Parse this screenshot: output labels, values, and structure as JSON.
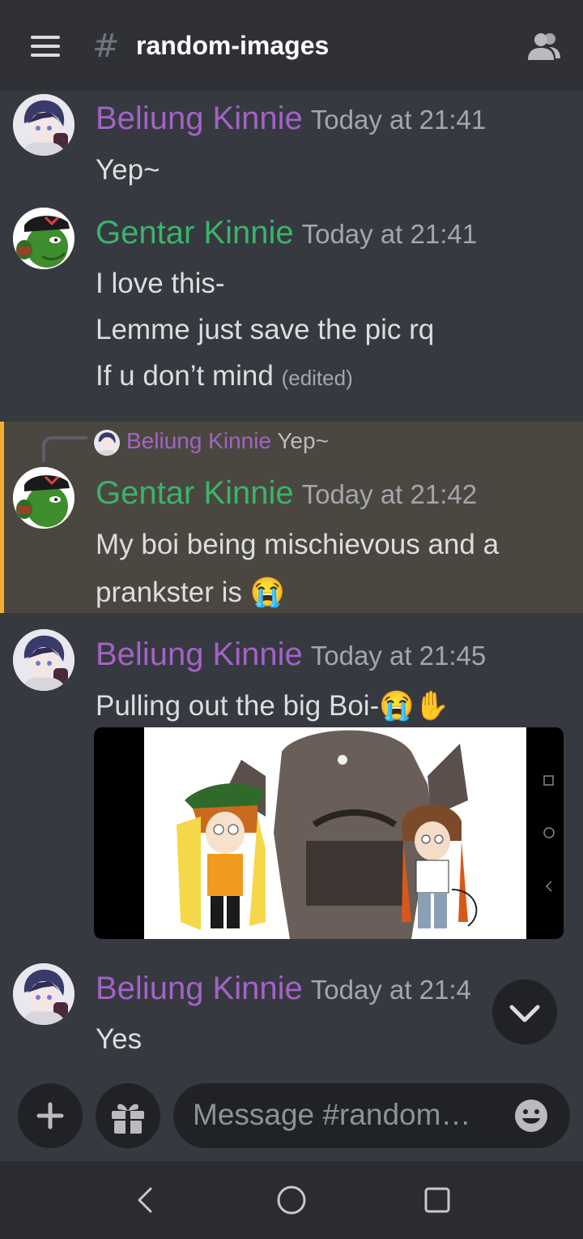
{
  "header": {
    "channel_prefix": "#",
    "channel_name": "random-images",
    "menu_icon": "hamburger-menu-icon",
    "members_icon": "members-icon"
  },
  "messages": [
    {
      "author": "Beliung Kinnie",
      "author_color": "#a363c6",
      "timestamp": "Today at 21:41",
      "lines": [
        "Yep~"
      ]
    },
    {
      "author": "Gentar Kinnie",
      "author_color": "#3bb36b",
      "timestamp": "Today at 21:41",
      "lines": [
        "I love this-",
        "Lemme just save the pic rq",
        "If u don’t mind"
      ],
      "edited": "(edited)"
    },
    {
      "reply_to": {
        "author": "Beliung Kinnie",
        "text": "Yep~"
      },
      "author": "Gentar Kinnie",
      "author_color": "#3bb36b",
      "timestamp": "Today at 21:42",
      "lines": [
        "My boi being mischievous and a",
        "prankster is 😭"
      ],
      "highlight_color": "#f0b232"
    },
    {
      "author": "Beliung Kinnie",
      "author_color": "#a363c6",
      "timestamp": "Today at 21:45",
      "lines": [
        "Pulling out the big Boi-😭✋"
      ],
      "attachment": "image"
    },
    {
      "author": "Beliung Kinnie",
      "author_color": "#a363c6",
      "timestamp": "Today at 21:4",
      "lines": [
        "Yes"
      ]
    }
  ],
  "composer": {
    "placeholder": "Message #random…",
    "add_icon": "plus-icon",
    "gift_icon": "gift-icon",
    "emoji_icon": "emoji-icon"
  },
  "navigation": {
    "back_icon": "back-icon",
    "home_icon": "home-icon",
    "recents_icon": "recents-icon"
  },
  "colors": {
    "background": "#36393f",
    "header": "#2f3136",
    "input": "#202225",
    "mention_highlight": "#4a4740"
  }
}
